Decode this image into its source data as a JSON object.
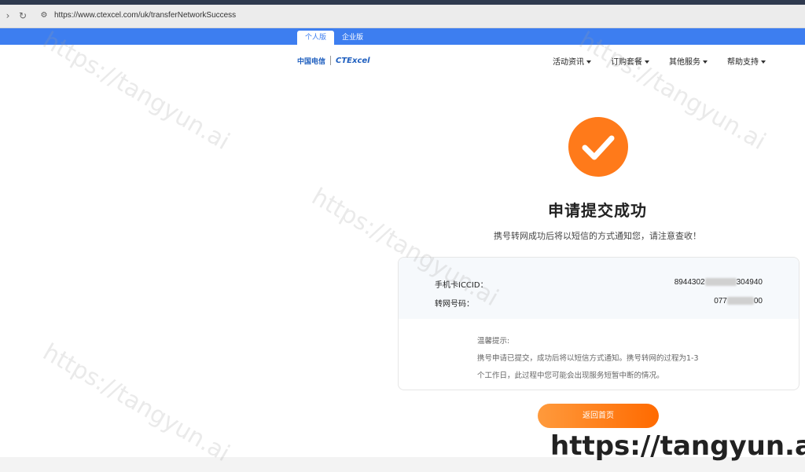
{
  "browser": {
    "url": "https://www.ctexcel.com/uk/transferNetworkSuccess"
  },
  "site_tabs": [
    {
      "label": "个人版"
    },
    {
      "label": "企业版"
    }
  ],
  "nav": [
    {
      "label": "活动资讯"
    },
    {
      "label": "订购套餐"
    },
    {
      "label": "其他服务"
    },
    {
      "label": "帮助支持"
    }
  ],
  "logo": {
    "ct_text": "中国电信",
    "brand_text": "CTExcel"
  },
  "success": {
    "title": "申请提交成功",
    "subtitle": "携号转网成功后将以短信的方式通知您，请注意查收！"
  },
  "details": {
    "iccid_label": "手机卡ICCID：",
    "iccid_value_start": "8944302",
    "iccid_value_end": "304940",
    "number_label": "转网号码：",
    "number_value_start": "077",
    "number_value_end": "00"
  },
  "tips": {
    "title": "温馨提示:",
    "line1": "携号申请已提交，成功后将以短信方式通知。携号转网的过程为1-3",
    "line2": "个工作日，此过程中您可能会出现服务短暂中断的情况。"
  },
  "back_button": "返回首页",
  "watermark": "https://tangyun.ai",
  "colors": {
    "accent": "#ff7a1a",
    "brand_blue": "#3d7ef0"
  }
}
